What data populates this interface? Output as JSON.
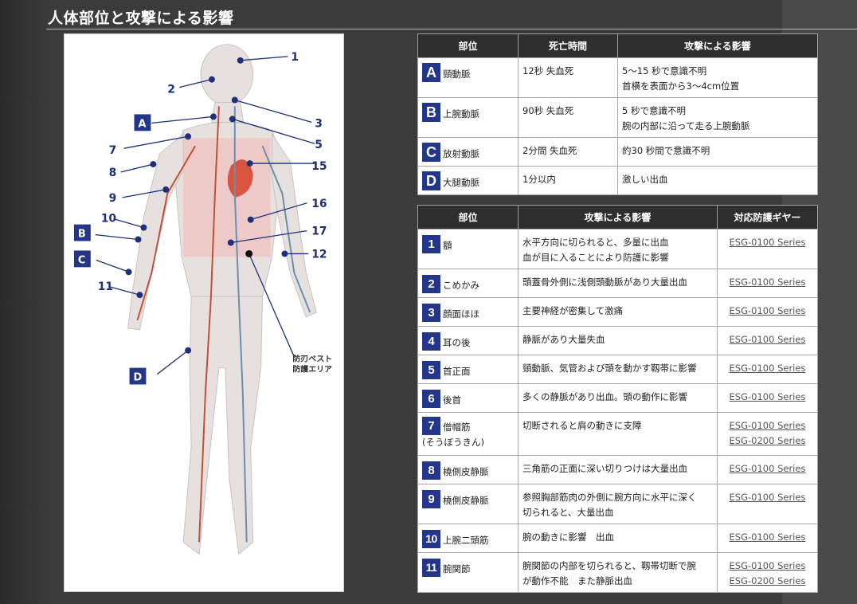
{
  "page_title": "人体部位と攻撃による影響",
  "figure": {
    "labels": [
      "1",
      "2",
      "3",
      "5",
      "7",
      "8",
      "9",
      "10",
      "11",
      "12",
      "15",
      "16",
      "17"
    ],
    "letter_labels": [
      "A",
      "B",
      "C",
      "D"
    ],
    "vest_note_line1": "防刃ベスト",
    "vest_note_line2": "防護エリア"
  },
  "artery_table": {
    "headers": [
      "部位",
      "死亡時間",
      "攻撃による影響"
    ],
    "rows": [
      {
        "badge": "A",
        "part": "頸動脈",
        "time": "12秒 失血死",
        "effect1": "5〜15 秒で意識不明",
        "effect2": "首横を表面から3〜4cm位置"
      },
      {
        "badge": "B",
        "part": "上腕動脈",
        "time": "90秒 失血死",
        "effect1": "5 秒で意識不明",
        "effect2": "腕の内部に沿って走る上腕動脈"
      },
      {
        "badge": "C",
        "part": "放射動脈",
        "time": "2分間 失血死",
        "effect1": "約30 秒間で意識不明",
        "effect2": ""
      },
      {
        "badge": "D",
        "part": "大腿動脈",
        "time": "1分以内",
        "effect1": "激しい出血",
        "effect2": ""
      }
    ]
  },
  "part_table": {
    "headers": [
      "部位",
      "攻撃による影響",
      "対応防護ギヤー"
    ],
    "rows": [
      {
        "badge": "1",
        "part": "額",
        "sub": "",
        "effect1": "水平方向に切られると、多量に出血",
        "effect2": "血が目に入ることにより防護に影響",
        "gear1": "ESG-0100 Series",
        "gear2": ""
      },
      {
        "badge": "2",
        "part": "こめかみ",
        "sub": "",
        "effect1": "頭蓋骨外側に浅側頭動脈があり大量出血",
        "effect2": "",
        "gear1": "ESG-0100 Series",
        "gear2": ""
      },
      {
        "badge": "3",
        "part": "顔面ほほ",
        "sub": "",
        "effect1": "主要神経が密集して激痛",
        "effect2": "",
        "gear1": "ESG-0100 Series",
        "gear2": ""
      },
      {
        "badge": "4",
        "part": "耳の後",
        "sub": "",
        "effect1": "静脈があり大量失血",
        "effect2": "",
        "gear1": "ESG-0100 Series",
        "gear2": ""
      },
      {
        "badge": "5",
        "part": "首正面",
        "sub": "",
        "effect1": "頸動脈、気管および頭を動かす靱帯に影響",
        "effect2": "",
        "gear1": "ESG-0100 Series",
        "gear2": ""
      },
      {
        "badge": "6",
        "part": "後首",
        "sub": "",
        "effect1": "多くの静脈があり出血。頭の動作に影響",
        "effect2": "",
        "gear1": "ESG-0100 Series",
        "gear2": ""
      },
      {
        "badge": "7",
        "part": "僧帽筋",
        "sub": "(そうぼうきん)",
        "effect1": "切断されると肩の動きに支障",
        "effect2": "",
        "gear1": "ESG-0100 Series",
        "gear2": "ESG-0200 Series"
      },
      {
        "badge": "8",
        "part": "橈側皮静脈",
        "sub": "",
        "effect1": "三角筋の正面に深い切りつけは大量出血",
        "effect2": "",
        "gear1": "ESG-0100 Series",
        "gear2": ""
      },
      {
        "badge": "9",
        "part": "橈側皮静脈",
        "sub": "",
        "effect1": "参照胸部筋肉の外側に腕方向に水平に深く",
        "effect2": "切られると、大量出血",
        "gear1": "ESG-0100 Series",
        "gear2": ""
      },
      {
        "badge": "10",
        "part": "上腕二頭筋",
        "sub": "",
        "effect1": "腕の動きに影響　出血",
        "effect2": "",
        "gear1": "ESG-0100 Series",
        "gear2": ""
      },
      {
        "badge": "11",
        "part": "腕関節",
        "sub": "",
        "effect1": "腕関節の内部を切られると、靱帯切断で腕",
        "effect2": "が動作不能　また静脈出血",
        "gear1": "ESG-0100 Series",
        "gear2": "ESG-0200 Series"
      }
    ]
  }
}
